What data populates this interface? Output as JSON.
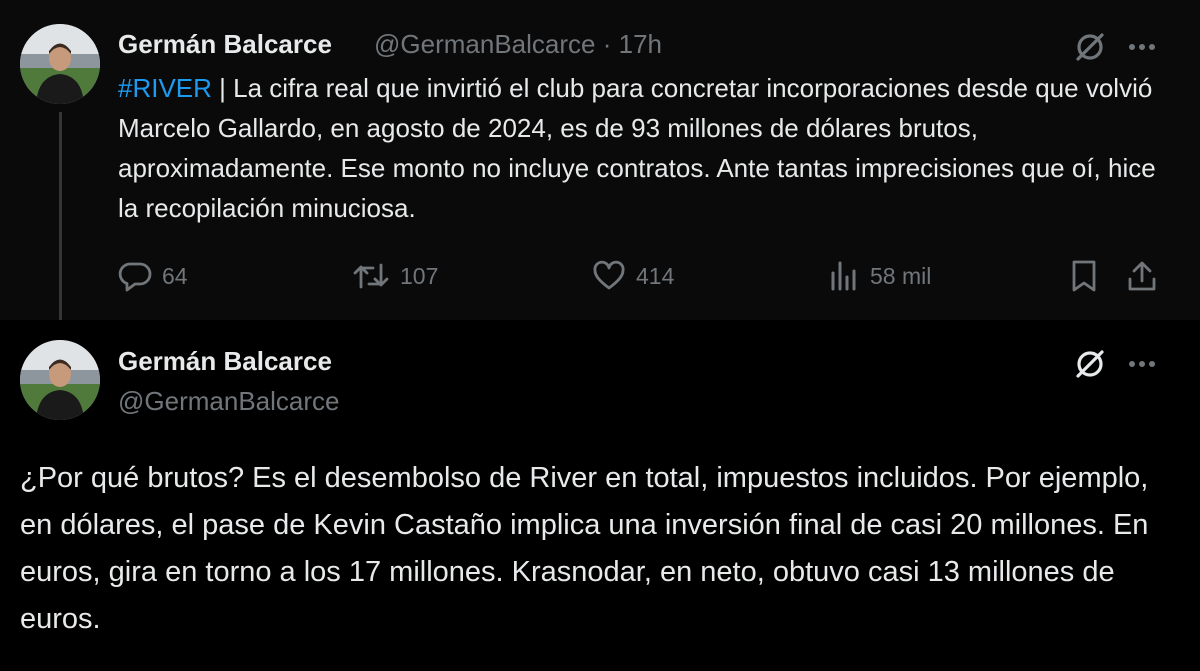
{
  "tweet1": {
    "author_name": "Germán Balcarce",
    "author_handle": "@GermanBalcarce",
    "separator": "·",
    "time": "17h",
    "hashtag": "#RIVER",
    "text": " | La cifra real que invirtió el club para concretar incorporaciones desde que volvió Marcelo Gallardo, en agosto de 2024, es de 93 millones de dólares brutos, aproximadamente. Ese monto no incluye contratos. Ante tantas imprecisiones que oí, hice la recopilación minuciosa.",
    "metrics": {
      "replies": "64",
      "retweets": "107",
      "likes": "414",
      "views": "58 mil"
    }
  },
  "tweet2": {
    "author_name": "Germán Balcarce",
    "author_handle": "@GermanBalcarce",
    "text": "¿Por qué brutos? Es el desembolso de River en total, impuestos incluidos. Por ejemplo, en dólares, el pase de Kevin Castaño implica una inversión final de casi 20 millones. En euros, gira en torno a los 17 millones. Krasnodar, en neto, obtuvo casi 13 millones de euros."
  },
  "icons": {
    "grok": "grok-icon",
    "more": "more-icon",
    "reply": "reply-icon",
    "retweet": "retweet-icon",
    "like": "heart-icon",
    "views": "views-icon",
    "bookmark": "bookmark-icon",
    "share": "share-icon"
  },
  "colors": {
    "background": "#000000",
    "first_tweet_background": "#0a0a0a",
    "text": "#e7e9ea",
    "secondary": "#71767b",
    "link": "#1d9bf0"
  }
}
